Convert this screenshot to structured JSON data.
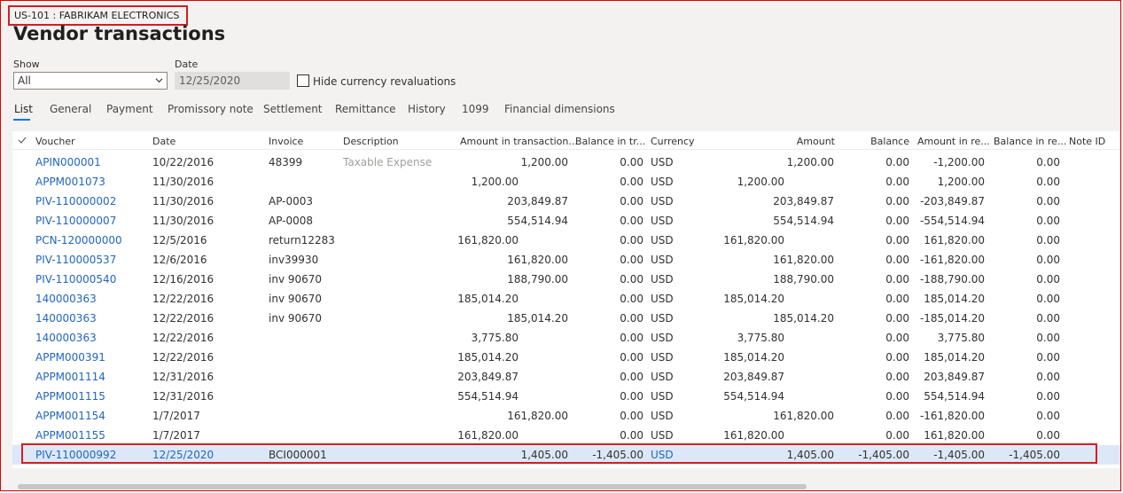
{
  "header": {
    "company": "US-101 : FABRIKAM ELECTRONICS",
    "title": "Vendor transactions"
  },
  "filters": {
    "show_label": "Show",
    "show_value": "All",
    "date_label": "Date",
    "date_value": "12/25/2020",
    "hide_reval_label": "Hide currency revaluations",
    "hide_reval_checked": false
  },
  "tabs": [
    "List",
    "General",
    "Payment",
    "Promissory note",
    "Settlement",
    "Remittance",
    "History",
    "1099",
    "Financial dimensions"
  ],
  "columns": [
    "Voucher",
    "Date",
    "Invoice",
    "Description",
    "Amount in transaction...",
    "Balance in tr...",
    "Currency",
    "Amount",
    "Balance",
    "Amount in re...",
    "Balance in re...",
    "Note ID"
  ],
  "rows": [
    {
      "voucher": "APIN000001",
      "date": "10/22/2016",
      "invoice": "48399",
      "description": "Taxable Expense",
      "amount_tx_debit": "",
      "amount_tx_credit": "1,200.00",
      "balance_tx": "0.00",
      "currency": "USD",
      "amount_debit": "",
      "amount_credit": "1,200.00",
      "balance": "0.00",
      "amount_rep": "-1,200.00",
      "balance_rep": "0.00"
    },
    {
      "voucher": "APPM001073",
      "date": "11/30/2016",
      "invoice": "",
      "description": "",
      "amount_tx_debit": "1,200.00",
      "amount_tx_credit": "",
      "balance_tx": "0.00",
      "currency": "USD",
      "amount_debit": "1,200.00",
      "amount_credit": "",
      "balance": "0.00",
      "amount_rep": "1,200.00",
      "balance_rep": "0.00"
    },
    {
      "voucher": "PIV-110000002",
      "date": "11/30/2016",
      "invoice": "AP-0003",
      "description": "",
      "amount_tx_debit": "",
      "amount_tx_credit": "203,849.87",
      "balance_tx": "0.00",
      "currency": "USD",
      "amount_debit": "",
      "amount_credit": "203,849.87",
      "balance": "0.00",
      "amount_rep": "-203,849.87",
      "balance_rep": "0.00"
    },
    {
      "voucher": "PIV-110000007",
      "date": "11/30/2016",
      "invoice": "AP-0008",
      "description": "",
      "amount_tx_debit": "",
      "amount_tx_credit": "554,514.94",
      "balance_tx": "0.00",
      "currency": "USD",
      "amount_debit": "",
      "amount_credit": "554,514.94",
      "balance": "0.00",
      "amount_rep": "-554,514.94",
      "balance_rep": "0.00"
    },
    {
      "voucher": "PCN-120000000",
      "date": "12/5/2016",
      "invoice": "return12283",
      "description": "",
      "amount_tx_debit": "161,820.00",
      "amount_tx_credit": "",
      "balance_tx": "0.00",
      "currency": "USD",
      "amount_debit": "161,820.00",
      "amount_credit": "",
      "balance": "0.00",
      "amount_rep": "161,820.00",
      "balance_rep": "0.00"
    },
    {
      "voucher": "PIV-110000537",
      "date": "12/6/2016",
      "invoice": "inv39930",
      "description": "",
      "amount_tx_debit": "",
      "amount_tx_credit": "161,820.00",
      "balance_tx": "0.00",
      "currency": "USD",
      "amount_debit": "",
      "amount_credit": "161,820.00",
      "balance": "0.00",
      "amount_rep": "-161,820.00",
      "balance_rep": "0.00"
    },
    {
      "voucher": "PIV-110000540",
      "date": "12/16/2016",
      "invoice": "inv 90670",
      "description": "",
      "amount_tx_debit": "",
      "amount_tx_credit": "188,790.00",
      "balance_tx": "0.00",
      "currency": "USD",
      "amount_debit": "",
      "amount_credit": "188,790.00",
      "balance": "0.00",
      "amount_rep": "-188,790.00",
      "balance_rep": "0.00"
    },
    {
      "voucher": "140000363",
      "date": "12/22/2016",
      "invoice": "inv 90670",
      "description": "",
      "amount_tx_debit": "185,014.20",
      "amount_tx_credit": "",
      "balance_tx": "0.00",
      "currency": "USD",
      "amount_debit": "185,014.20",
      "amount_credit": "",
      "balance": "0.00",
      "amount_rep": "185,014.20",
      "balance_rep": "0.00"
    },
    {
      "voucher": "140000363",
      "date": "12/22/2016",
      "invoice": "inv 90670",
      "description": "",
      "amount_tx_debit": "",
      "amount_tx_credit": "185,014.20",
      "balance_tx": "0.00",
      "currency": "USD",
      "amount_debit": "",
      "amount_credit": "185,014.20",
      "balance": "0.00",
      "amount_rep": "-185,014.20",
      "balance_rep": "0.00"
    },
    {
      "voucher": "140000363",
      "date": "12/22/2016",
      "invoice": "",
      "description": "",
      "amount_tx_debit": "3,775.80",
      "amount_tx_credit": "",
      "balance_tx": "0.00",
      "currency": "USD",
      "amount_debit": "3,775.80",
      "amount_credit": "",
      "balance": "0.00",
      "amount_rep": "3,775.80",
      "balance_rep": "0.00"
    },
    {
      "voucher": "APPM000391",
      "date": "12/22/2016",
      "invoice": "",
      "description": "",
      "amount_tx_debit": "185,014.20",
      "amount_tx_credit": "",
      "balance_tx": "0.00",
      "currency": "USD",
      "amount_debit": "185,014.20",
      "amount_credit": "",
      "balance": "0.00",
      "amount_rep": "185,014.20",
      "balance_rep": "0.00"
    },
    {
      "voucher": "APPM001114",
      "date": "12/31/2016",
      "invoice": "",
      "description": "",
      "amount_tx_debit": "203,849.87",
      "amount_tx_credit": "",
      "balance_tx": "0.00",
      "currency": "USD",
      "amount_debit": "203,849.87",
      "amount_credit": "",
      "balance": "0.00",
      "amount_rep": "203,849.87",
      "balance_rep": "0.00"
    },
    {
      "voucher": "APPM001115",
      "date": "12/31/2016",
      "invoice": "",
      "description": "",
      "amount_tx_debit": "554,514.94",
      "amount_tx_credit": "",
      "balance_tx": "0.00",
      "currency": "USD",
      "amount_debit": "554,514.94",
      "amount_credit": "",
      "balance": "0.00",
      "amount_rep": "554,514.94",
      "balance_rep": "0.00"
    },
    {
      "voucher": "APPM001154",
      "date": "1/7/2017",
      "invoice": "",
      "description": "",
      "amount_tx_debit": "",
      "amount_tx_credit": "161,820.00",
      "balance_tx": "0.00",
      "currency": "USD",
      "amount_debit": "",
      "amount_credit": "161,820.00",
      "balance": "0.00",
      "amount_rep": "-161,820.00",
      "balance_rep": "0.00"
    },
    {
      "voucher": "APPM001155",
      "date": "1/7/2017",
      "invoice": "",
      "description": "",
      "amount_tx_debit": "161,820.00",
      "amount_tx_credit": "",
      "balance_tx": "0.00",
      "currency": "USD",
      "amount_debit": "161,820.00",
      "amount_credit": "",
      "balance": "0.00",
      "amount_rep": "161,820.00",
      "balance_rep": "0.00"
    },
    {
      "voucher": "PIV-110000992",
      "date": "12/25/2020",
      "invoice": "BCI000001",
      "description": "",
      "amount_tx_debit": "",
      "amount_tx_credit": "1,405.00",
      "balance_tx": "-1,405.00",
      "currency": "USD",
      "amount_debit": "",
      "amount_credit": "1,405.00",
      "balance": "-1,405.00",
      "amount_rep": "-1,405.00",
      "balance_rep": "-1,405.00",
      "selected": true
    }
  ],
  "colors": {
    "link": "#2266c0",
    "accent": "#0078d4",
    "highlight_border": "#d61e1e",
    "selected_row": "#dce8f7"
  }
}
